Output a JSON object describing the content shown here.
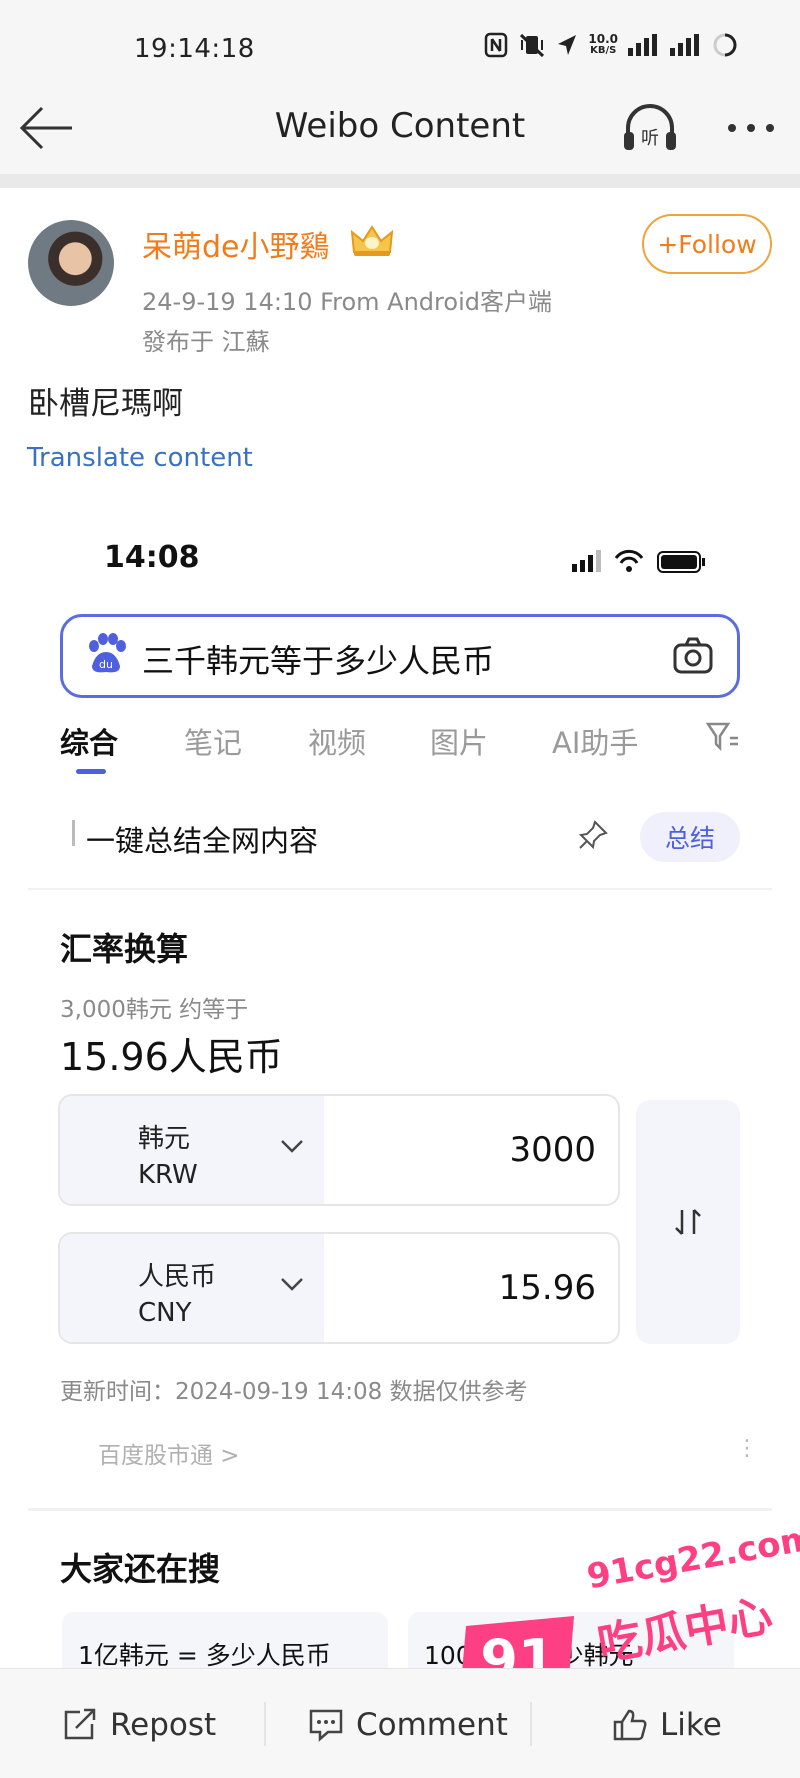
{
  "status_bar": {
    "time": "19:14:18",
    "net_speed": "10.0",
    "net_unit": "KB/S"
  },
  "header": {
    "title": "Weibo Content",
    "listen_label": "听"
  },
  "post": {
    "username": "呆萌de小野鷄",
    "meta": "24-9-19 14:10  From Android客户端",
    "location": "發布于 江蘇",
    "follow_label": "+Follow",
    "text": "卧槽尼瑪啊",
    "translate_label": "Translate content"
  },
  "embedded": {
    "time": "14:08",
    "search_query": "三千韩元等于多少人民币",
    "search_logo_text": "du",
    "tabs": [
      {
        "label": "综合",
        "active": true
      },
      {
        "label": "笔记"
      },
      {
        "label": "视频"
      },
      {
        "label": "图片"
      },
      {
        "label": "AI助手"
      }
    ],
    "summary_text": "一键总结全网内容",
    "summary_button": "总结",
    "converter": {
      "title": "汇率换算",
      "subtitle": "3,000韩元 约等于",
      "result": "15.96人民币",
      "from": {
        "name": "韩元",
        "code": "KRW",
        "value": "3000"
      },
      "to": {
        "name": "人民币",
        "code": "CNY",
        "value": "15.96"
      },
      "update_text": "更新时间：2024-09-19 14:08 数据仅供参考",
      "source": "百度股市通 >"
    },
    "also_search": {
      "title": "大家还在搜",
      "items": [
        "1亿韩元 = 多少人民币",
        "100元 = 多少韩元"
      ]
    }
  },
  "watermark": {
    "badge": "91",
    "domain": "91cg22.com",
    "name": "吃瓜中心"
  },
  "bottom_bar": {
    "repost": "Repost",
    "comment": "Comment",
    "like": "Like"
  },
  "colors": {
    "username": "#f07c1c",
    "link": "#3a72c2",
    "accent": "#4e5fe0",
    "watermark": "#ff3f84"
  }
}
